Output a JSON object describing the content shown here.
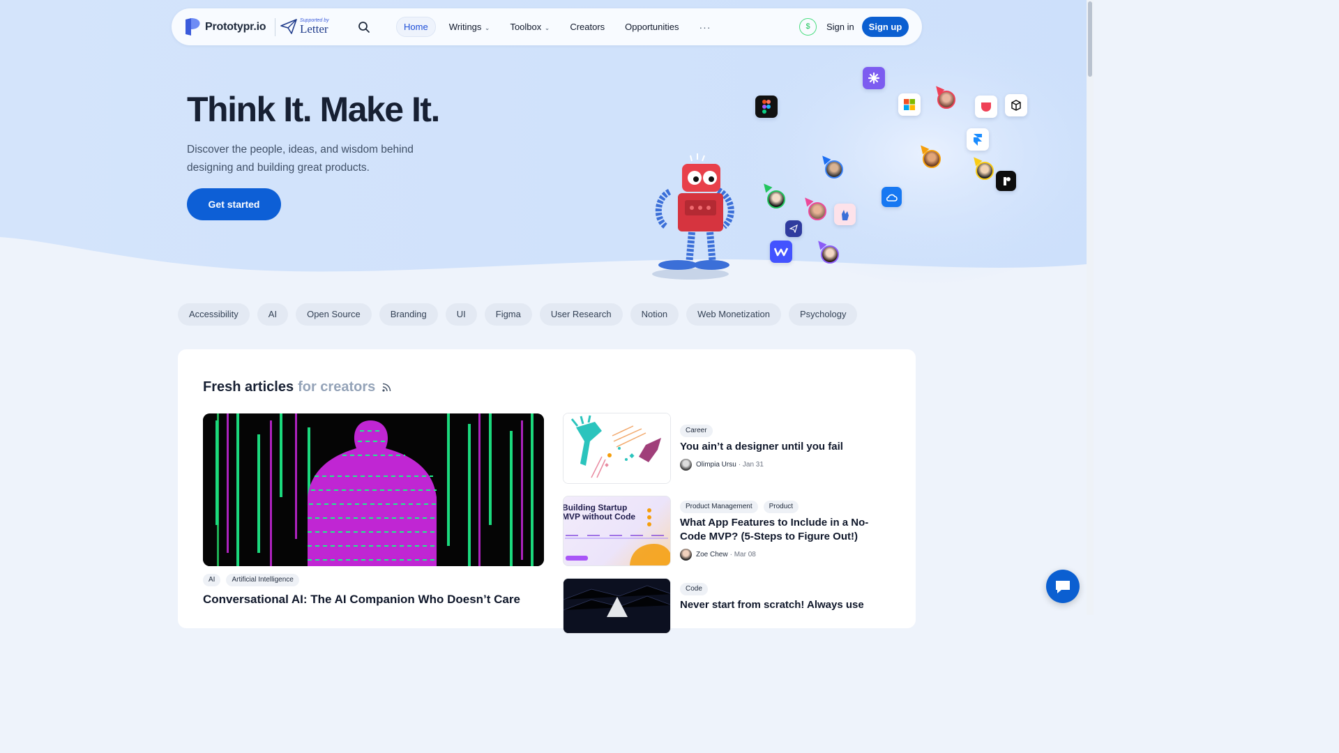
{
  "nav": {
    "logo": "Prototypr.io",
    "sponsor_small": "Supported by",
    "sponsor_name": "Letter",
    "links": [
      {
        "label": "Home",
        "active": true
      },
      {
        "label": "Writings",
        "dropdown": true
      },
      {
        "label": "Toolbox",
        "dropdown": true
      },
      {
        "label": "Creators"
      },
      {
        "label": "Opportunities"
      }
    ],
    "more": "···",
    "signin": "Sign in",
    "signup": "Sign up",
    "dollar_icon": "$"
  },
  "hero": {
    "title": "Think It. Make It.",
    "subtitle": "Discover the people, ideas, and wisdom behind designing and building great products.",
    "cta": "Get started"
  },
  "tags": [
    "Accessibility",
    "AI",
    "Open Source",
    "Branding",
    "UI",
    "Figma",
    "User Research",
    "Notion",
    "Web Monetization",
    "Psychology"
  ],
  "section": {
    "title": "Fresh articles",
    "title_muted": "for creators"
  },
  "featured": {
    "tags": [
      "AI",
      "Artificial Intelligence"
    ],
    "title": "Conversational AI: The AI Companion Who Doesn’t Care"
  },
  "articles": [
    {
      "tags": [
        "Career"
      ],
      "title": "You ain’t a designer until you fail",
      "author": "Olimpia Ursu",
      "date": "Jan 31"
    },
    {
      "tags": [
        "Product Management",
        "Product"
      ],
      "title": "What App Features to Include in a No-Code MVP? (5-Steps to Figure Out!)",
      "author": "Zoe Chew",
      "date": "Mar 08",
      "thumb_heading": "Building Startup MVP without Code"
    },
    {
      "tags": [
        "Code"
      ],
      "title": "Never start from scratch! Always use",
      "author": "",
      "date": ""
    }
  ],
  "colors": {
    "primary": "#0d5fd6",
    "hero_bg": "#d6e6fc",
    "page_bg": "#eef3fb"
  }
}
